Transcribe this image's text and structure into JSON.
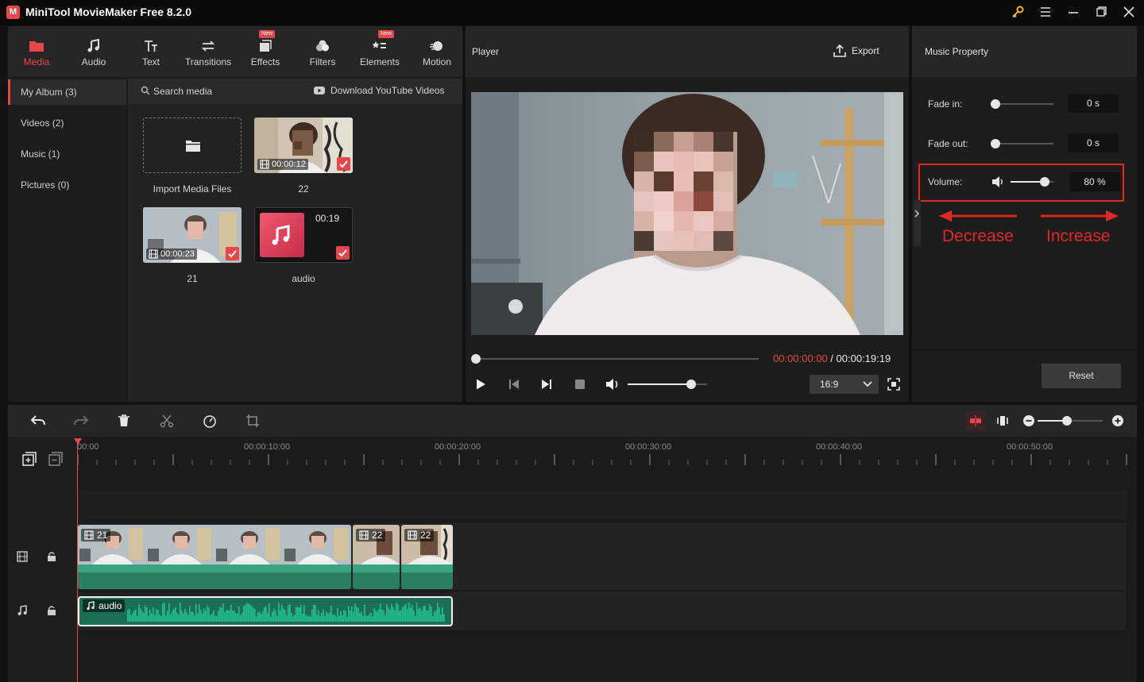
{
  "app": {
    "title": "MiniTool MovieMaker Free 8.2.0",
    "logo_letter": "M"
  },
  "toolbar": {
    "tabs": [
      {
        "label": "Media",
        "icon": "media-folder-icon"
      },
      {
        "label": "Audio",
        "icon": "music-note-icon"
      },
      {
        "label": "Text",
        "icon": "text-icon"
      },
      {
        "label": "Transitions",
        "icon": "transition-arrows-icon"
      },
      {
        "label": "Effects",
        "icon": "effects-icon",
        "badge": "New"
      },
      {
        "label": "Filters",
        "icon": "filters-icon"
      },
      {
        "label": "Elements",
        "icon": "elements-icon",
        "badge": "New"
      },
      {
        "label": "Motion",
        "icon": "motion-icon"
      }
    ],
    "active": "Media"
  },
  "album": {
    "items": [
      "My Album (3)",
      "Videos (2)",
      "Music (1)",
      "Pictures (0)"
    ]
  },
  "media": {
    "search_placeholder": "Search media",
    "download_label": "Download YouTube Videos",
    "import_label": "Import Media Files",
    "items": [
      {
        "name": "22",
        "duration": "00:00:12"
      },
      {
        "name": "21",
        "duration": "00:00:23"
      },
      {
        "name": "audio",
        "duration": "00:19"
      }
    ]
  },
  "player": {
    "title": "Player",
    "export_label": "Export",
    "time_current": "00:00:00:00",
    "time_sep": " / ",
    "time_total": "00:00:19:19",
    "aspect": "16:9",
    "volume_level": 0.8
  },
  "property": {
    "title": "Music Property",
    "fade_in_label": "Fade in:",
    "fade_in_value": "0 s",
    "fade_out_label": "Fade out:",
    "fade_out_value": "0 s",
    "volume_label": "Volume:",
    "volume_value": "80 %",
    "volume_level": 0.8,
    "decrease_label": "Decrease",
    "increase_label": "Increase",
    "reset_label": "Reset"
  },
  "timeline": {
    "ruler": [
      "00:00",
      "00:00:10:00",
      "00:00:20:00",
      "00:00:30:00",
      "00:00:40:00",
      "00:00:50:00"
    ],
    "clips": [
      {
        "name": "21"
      },
      {
        "name": "22"
      },
      {
        "name": "22"
      }
    ],
    "audio_clip": "audio",
    "zoom_level": 0.45
  },
  "colors": {
    "accent": "#e8474a",
    "clip_green": "#2f8f6c",
    "audio_green": "#1eb886"
  }
}
